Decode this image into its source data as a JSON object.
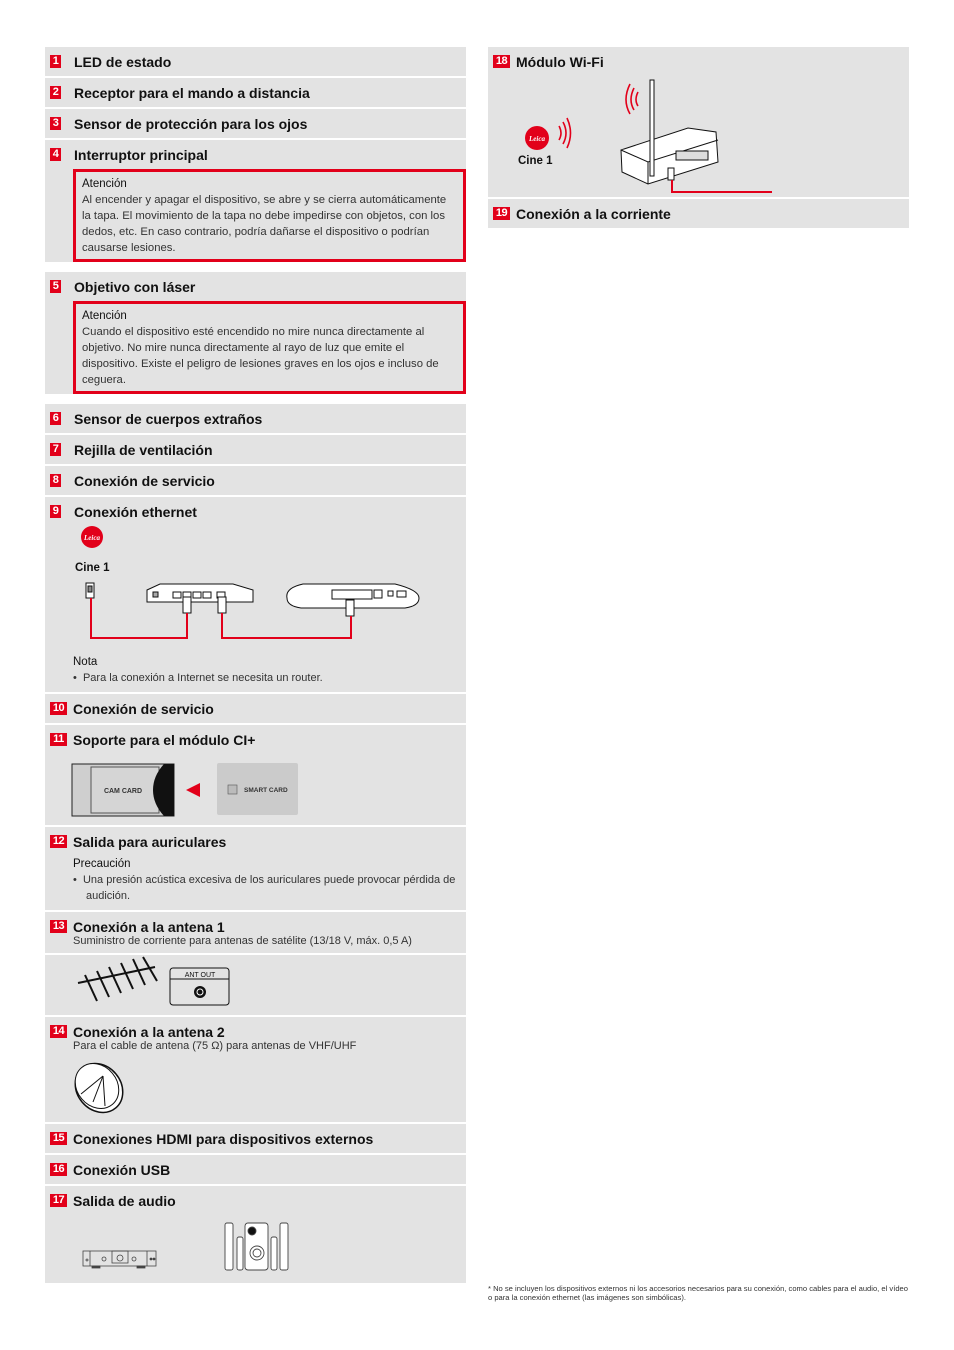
{
  "brand": {
    "accent_color": "#e2001a",
    "row_background": "#e3e3e3"
  },
  "items": [
    {
      "num": "1",
      "title": "LED de estado"
    },
    {
      "num": "2",
      "title": "Receptor para el mando a distancia"
    },
    {
      "num": "3",
      "title": "Sensor de protección para los ojos"
    },
    {
      "num": "4",
      "title": "Interruptor principal",
      "warning": {
        "heading": "Atención",
        "text": "Al encender y apagar el dispositivo, se abre y se cierra automáticamente la tapa. El movimiento de la tapa no debe impedirse con objetos, con los dedos, etc. En caso contrario, podría dañarse el dispositivo o podrían causarse lesiones."
      }
    },
    {
      "num": "5",
      "title": "Objetivo con láser",
      "warning": {
        "heading": "Atención",
        "text": "Cuando el dispositivo esté encendido no mire nunca directamente al objetivo. No mire nunca directamente al rayo de luz que emite el dispositivo. Existe el peligro de lesiones graves en los ojos e incluso de ceguera."
      }
    },
    {
      "num": "6",
      "title": "Sensor de cuerpos extraños"
    },
    {
      "num": "7",
      "title": "Rejilla de ventilación"
    },
    {
      "num": "8",
      "title": "Conexión de servicio"
    },
    {
      "num": "9",
      "title": "Conexión ethernet",
      "device_label": "Cine 1",
      "note": {
        "heading": "Nota",
        "bullet": "Para la conexión a Internet se necesita un router."
      }
    },
    {
      "num": "10",
      "title": "Conexión de servicio"
    },
    {
      "num": "11",
      "title": "Soporte para el módulo CI+",
      "cam_label": "CAM CARD",
      "smart_label": "SMART CARD"
    },
    {
      "num": "12",
      "title": "Salida para auriculares",
      "note": {
        "heading": "Precaución",
        "bullet": "Una presión acústica excesiva de los auriculares puede provocar pérdida de audición."
      }
    },
    {
      "num": "13",
      "title": "Conexión a la antena 1",
      "subtitle": "Suministro de corriente para antenas de satélite (13/18 V, máx. 0,5 A)",
      "port_label": "ANT OUT"
    },
    {
      "num": "14",
      "title": "Conexión a la antena 2",
      "subtitle": "Para el cable de antena (75 Ω) para antenas de VHF/UHF"
    },
    {
      "num": "15",
      "title": "Conexiones HDMI para dispositivos externos"
    },
    {
      "num": "16",
      "title": "Conexión USB"
    },
    {
      "num": "17",
      "title": "Salida de audio"
    },
    {
      "num": "18",
      "title": "Módulo Wi-Fi",
      "device_label": "Cine 1"
    },
    {
      "num": "19",
      "title": "Conexión a la corriente"
    }
  ],
  "footnote": "* No se incluyen los dispositivos externos ni los accesorios necesarios para su conexión, como cables para el audio, el vídeo o para la conexión ethernet (las imágenes son simbólicas)."
}
